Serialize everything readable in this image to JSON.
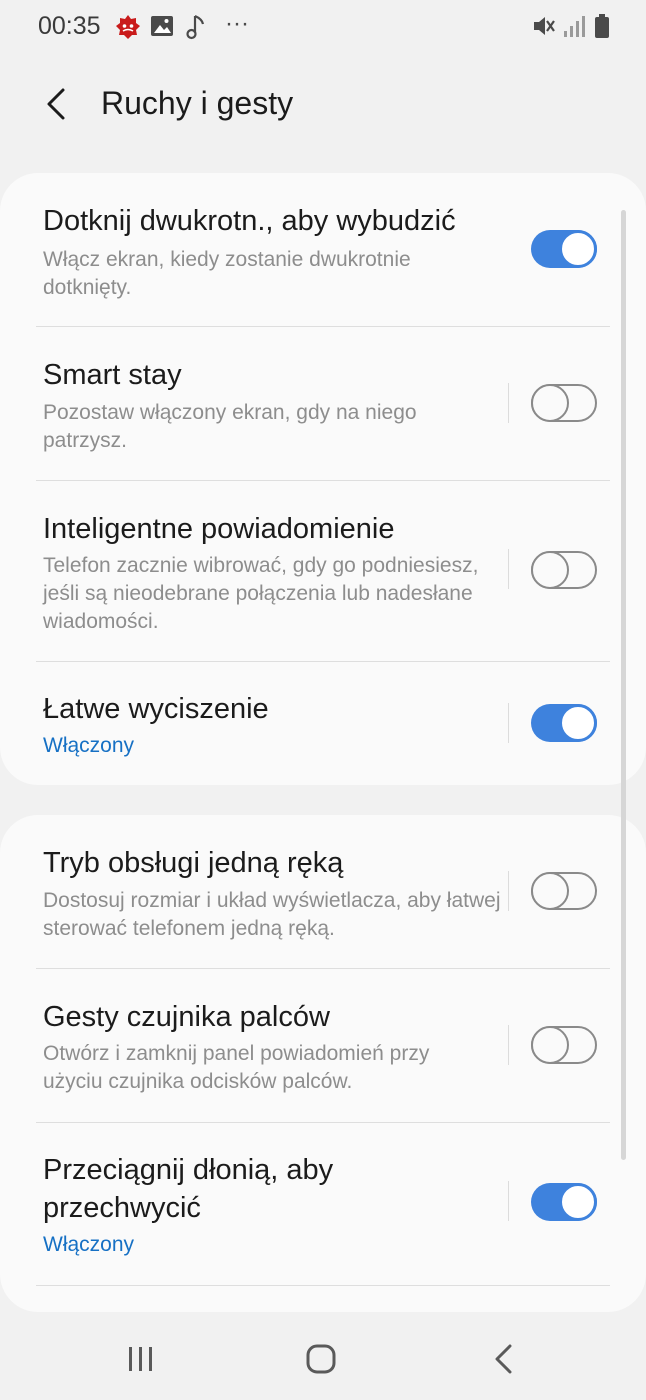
{
  "statusbar": {
    "time": "00:35",
    "icons_left": [
      "app-badge-icon",
      "gallery-icon",
      "music-note-icon",
      "more-icon"
    ],
    "more_glyph": "···",
    "icons_right": [
      "mute-icon",
      "signal-icon",
      "battery-icon"
    ]
  },
  "header": {
    "title": "Ruchy i gesty",
    "back_icon": "back-chevron-icon"
  },
  "colors": {
    "accent": "#3e82dd",
    "status_on": "#1670c4",
    "background": "#f1f1f1",
    "card": "#fafafa"
  },
  "groups": [
    {
      "items": [
        {
          "title": "Dotknij dwukrotn., aby wybudzić",
          "subtitle": "Włącz ekran, kiedy zostanie dwukrotnie dotknięty.",
          "enabled": true
        },
        {
          "title": "Smart stay",
          "subtitle": "Pozostaw włączony ekran, gdy na niego patrzysz.",
          "enabled": false
        },
        {
          "title": "Inteligentne powiadomienie",
          "subtitle": "Telefon zacznie wibrować, gdy go podniesiesz, jeśli są nieodebrane połączenia lub nadesłane wiadomości.",
          "enabled": false
        },
        {
          "title": "Łatwe wyciszenie",
          "subtitle": "Włączony",
          "enabled": true
        }
      ]
    },
    {
      "items": [
        {
          "title": "Tryb obsługi jedną ręką",
          "subtitle": "Dostosuj rozmiar i układ wyświetlacza, aby łatwej sterować telefonem jedną ręką.",
          "enabled": false
        },
        {
          "title": "Gesty czujnika palców",
          "subtitle": "Otwórz i zamknij panel powiadomień przy użyciu czujnika odcisków palców.",
          "enabled": false
        },
        {
          "title": "Przeciągnij dłonią, aby przechwycić",
          "subtitle": "Włączony",
          "enabled": true
        }
      ]
    }
  ],
  "navbar": {
    "buttons": [
      "recent-apps-icon",
      "home-icon",
      "back-icon"
    ]
  }
}
